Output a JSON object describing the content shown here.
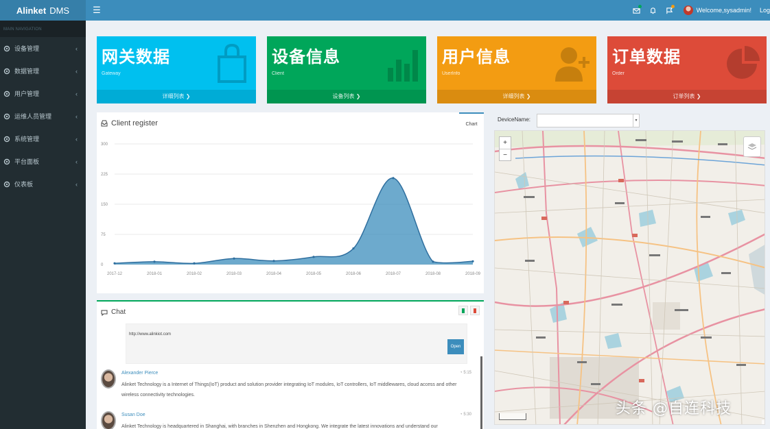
{
  "app": {
    "brand_bold": "Alinket",
    "brand_rest": "DMS"
  },
  "header": {
    "welcome": "Welcome,sysadmin!",
    "logout": "Log"
  },
  "sidebar": {
    "heading": "MAIN NAVIGATION",
    "items": [
      {
        "label": "设备管理"
      },
      {
        "label": "数据管理"
      },
      {
        "label": "用户管理"
      },
      {
        "label": "运维人员管理"
      },
      {
        "label": "系统管理"
      },
      {
        "label": "平台面板"
      },
      {
        "label": "仪表板"
      }
    ]
  },
  "boxes": [
    {
      "title": "网关数据",
      "sub": "Gateway",
      "foot": "详细列表 ❯",
      "color": "#00c0ef",
      "icon": "shopping-bag-icon"
    },
    {
      "title": "设备信息",
      "sub": "Client",
      "foot": "设备列表 ❯",
      "color": "#00a65a",
      "icon": "bar-chart-icon"
    },
    {
      "title": "用户信息",
      "sub": "UserInfo",
      "foot": "详细列表 ❯",
      "color": "#f39c12",
      "icon": "user-add-icon"
    },
    {
      "title": "订单数据",
      "sub": "Order",
      "foot": "订单列表 ❯",
      "color": "#dd4b39",
      "icon": "pie-chart-icon"
    }
  ],
  "chart_panel": {
    "title": "Client register",
    "tab": "Chart"
  },
  "chart_data": {
    "type": "area",
    "title": "Client register",
    "categories": [
      "2017-12",
      "2018-01",
      "2018-02",
      "2018-03",
      "2018-04",
      "2018-05",
      "2018-06",
      "2018-07",
      "2018-08",
      "2018-09"
    ],
    "series": [
      {
        "values": [
          3,
          7,
          3,
          15,
          9,
          19,
          40,
          215,
          7,
          8
        ]
      }
    ],
    "yticks": [
      0,
      75,
      150,
      225,
      300
    ],
    "ylim": [
      0,
      300
    ],
    "grid": true,
    "color": "#3c8dbc"
  },
  "chat": {
    "title": "Chat",
    "attachment_link": "http://www.alinkiot.com",
    "open_label": "Open",
    "messages": [
      {
        "name": "Alexander Pierce",
        "time": "5:15",
        "text": "Alinket Technology is a Internet of Things(IoT) product and solution provider integrating IoT modules, IoT controllers, IoT middlewares, cloud access and other wireless connectivity technologies."
      },
      {
        "name": "Susan Doe",
        "time": "5:30",
        "text": "Alinket Technology is headquartered in Shanghai, with branches in Shenzhen and Hongkong. We integrate the latest innovations and understand our"
      }
    ]
  },
  "map_panel": {
    "device_label": "DeviceName:",
    "selected": ""
  },
  "watermark": "头条 @自连科技"
}
